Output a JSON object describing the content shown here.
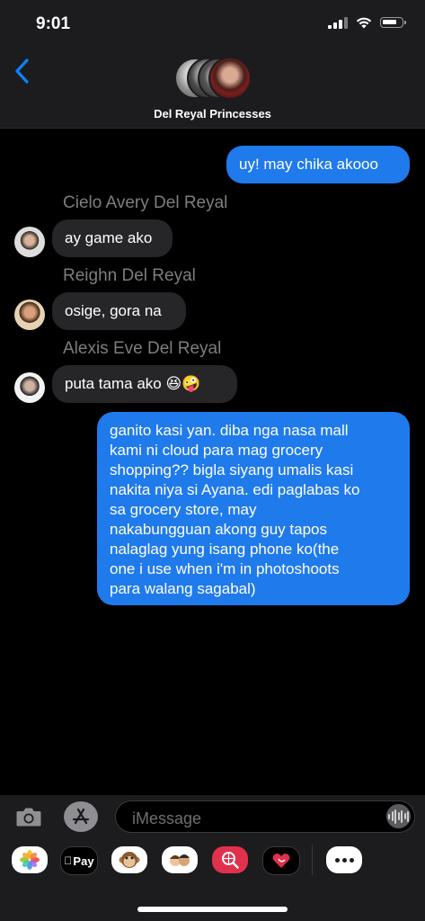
{
  "status_bar": {
    "time": "9:01"
  },
  "header": {
    "group_name": "Del Reyal Princesses"
  },
  "messages": [
    {
      "type": "sent",
      "text": "uy! may chika akooo"
    },
    {
      "type": "received",
      "sender": "Cielo Avery Del Reyal",
      "text": "ay game ako"
    },
    {
      "type": "received",
      "sender": "Reighn Del Reyal",
      "text": "osige, gora na"
    },
    {
      "type": "received",
      "sender": "Alexis Eve Del Reyal",
      "text": "puta tama ako 😆🤪"
    },
    {
      "type": "sent",
      "lines": [
        "ganito kasi yan. diba nga nasa mall",
        "kami ni cloud para mag grocery",
        "shopping?? bigla siyang umalis kasi",
        "nakita niya si Ayana. edi paglabas ko",
        "sa grocery store, may",
        "nakabungguan akong guy tapos",
        "nalaglag yung isang phone ko(the",
        "one i use when i'm in photoshoots",
        "para walang sagabal)"
      ]
    }
  ],
  "input": {
    "placeholder": "iMessage"
  },
  "app_drawer": {
    "items": [
      {
        "name": "photos",
        "icon": "photos-icon"
      },
      {
        "name": "apple-pay",
        "label": "Pay",
        "icon": "apple-pay-icon"
      },
      {
        "name": "animoji",
        "icon": "monkey-icon"
      },
      {
        "name": "memoji",
        "icon": "memoji-icon"
      },
      {
        "name": "images-search",
        "icon": "globe-search-icon"
      },
      {
        "name": "digital-touch",
        "icon": "heart-touch-icon"
      },
      {
        "name": "more",
        "icon": "more-icon"
      }
    ]
  },
  "colors": {
    "sent_bubble": "#1f7aec",
    "received_bubble": "#262628",
    "accent": "#0a84ff"
  }
}
